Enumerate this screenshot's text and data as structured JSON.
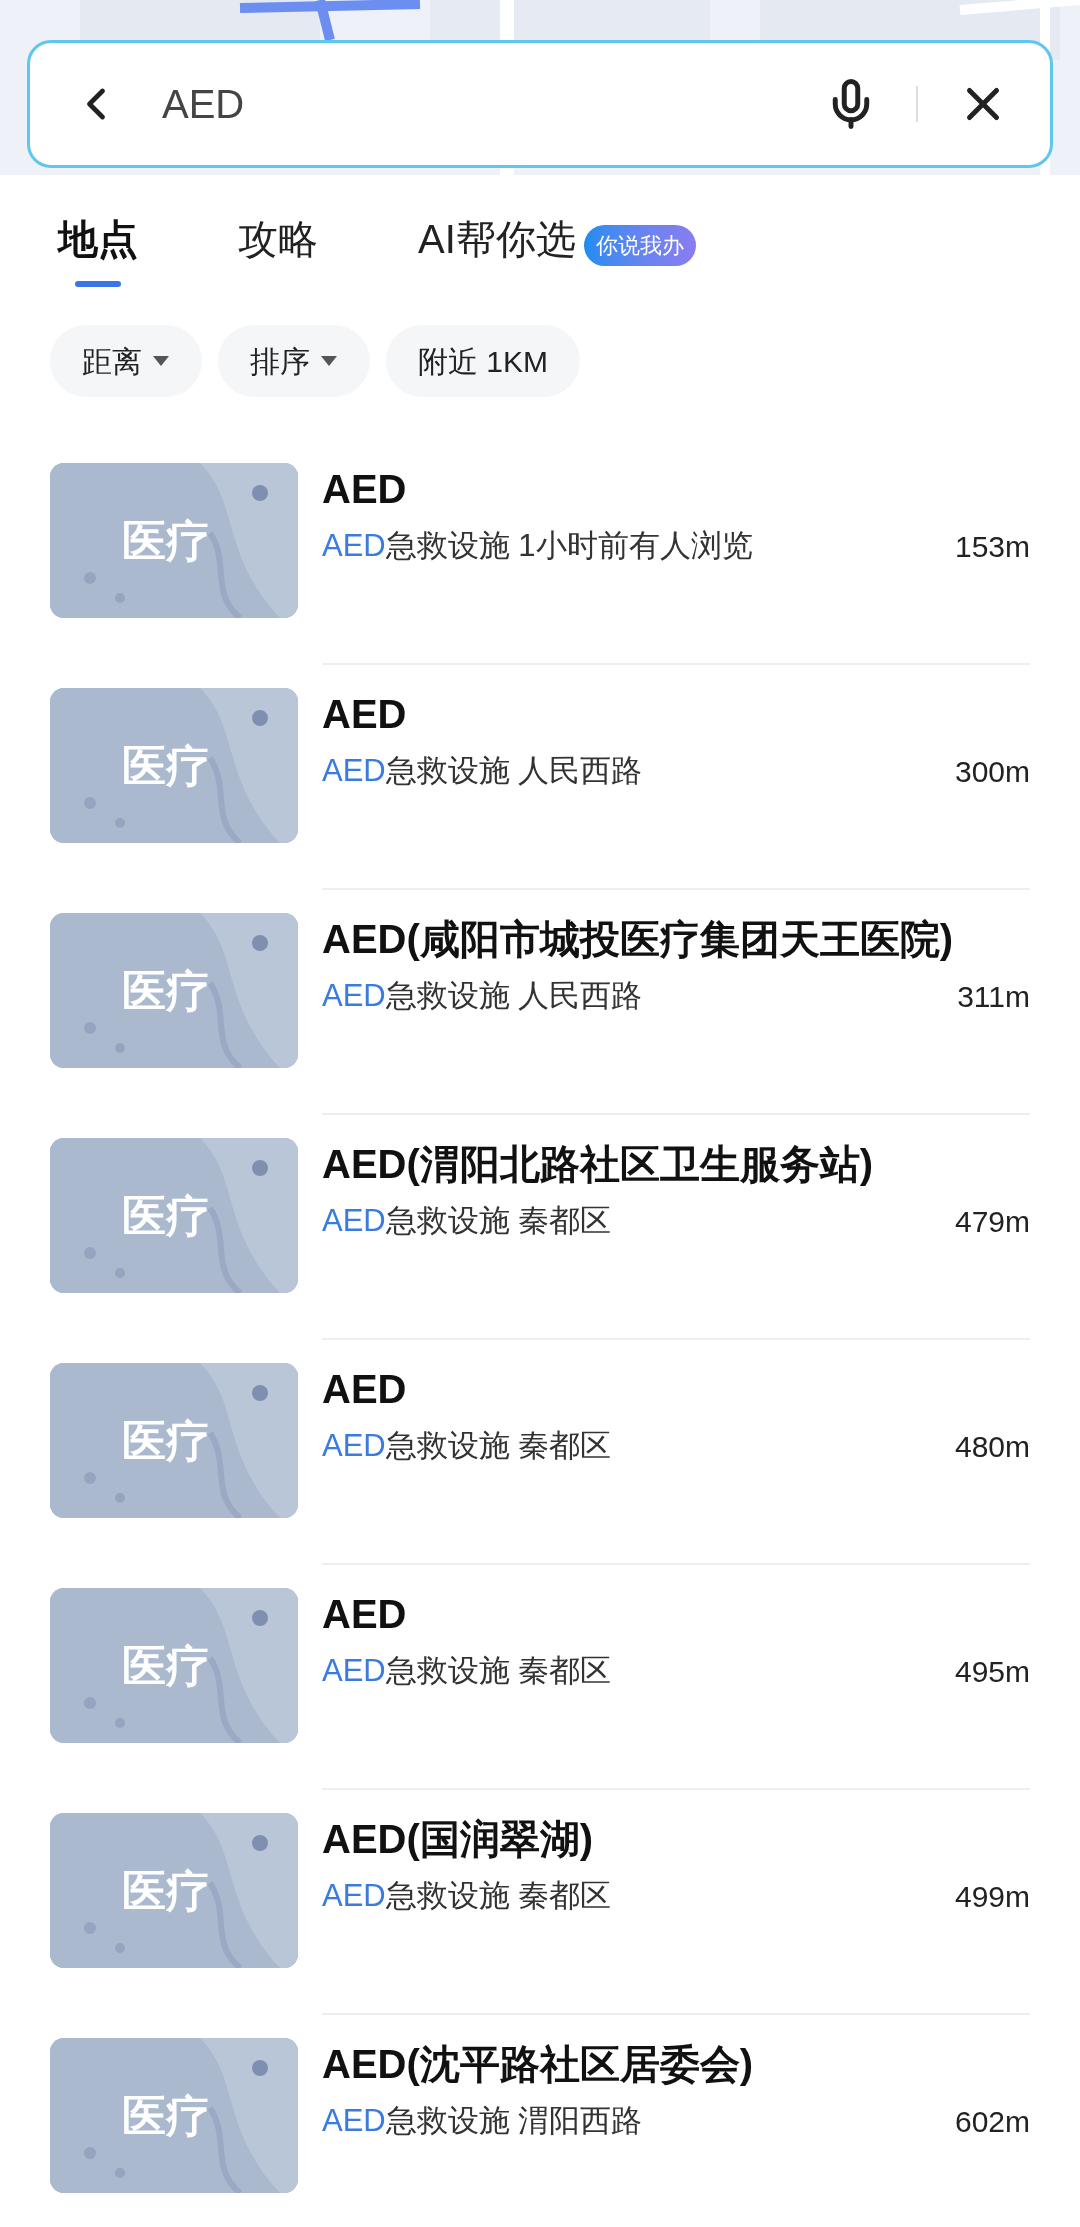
{
  "search": {
    "value": "AED"
  },
  "tabs": [
    {
      "label": "地点",
      "selected": true
    },
    {
      "label": "攻略",
      "selected": false
    },
    {
      "label": "AI帮你选",
      "selected": false,
      "badge": "你说我办"
    }
  ],
  "filters": [
    {
      "label": "距离",
      "dropdown": true
    },
    {
      "label": "排序",
      "dropdown": true
    },
    {
      "label": "附近 1KM",
      "dropdown": false
    }
  ],
  "results": [
    {
      "thumb_label": "医疗",
      "title": "AED",
      "highlight": "AED",
      "detail": "急救设施 1小时前有人浏览",
      "distance": "153m"
    },
    {
      "thumb_label": "医疗",
      "title": "AED",
      "highlight": "AED",
      "detail": "急救设施 人民西路",
      "distance": "300m"
    },
    {
      "thumb_label": "医疗",
      "title": "AED(咸阳市城投医疗集团天王医院)",
      "highlight": "AED",
      "detail": "急救设施 人民西路",
      "distance": "311m"
    },
    {
      "thumb_label": "医疗",
      "title": "AED(渭阳北路社区卫生服务站)",
      "highlight": "AED",
      "detail": "急救设施 秦都区",
      "distance": "479m"
    },
    {
      "thumb_label": "医疗",
      "title": "AED",
      "highlight": "AED",
      "detail": "急救设施 秦都区",
      "distance": "480m"
    },
    {
      "thumb_label": "医疗",
      "title": "AED",
      "highlight": "AED",
      "detail": "急救设施 秦都区",
      "distance": "495m"
    },
    {
      "thumb_label": "医疗",
      "title": "AED(国润翠湖)",
      "highlight": "AED",
      "detail": "急救设施 秦都区",
      "distance": "499m"
    },
    {
      "thumb_label": "医疗",
      "title": "AED(沈平路社区居委会)",
      "highlight": "AED",
      "detail": "急救设施 渭阳西路",
      "distance": "602m"
    }
  ]
}
